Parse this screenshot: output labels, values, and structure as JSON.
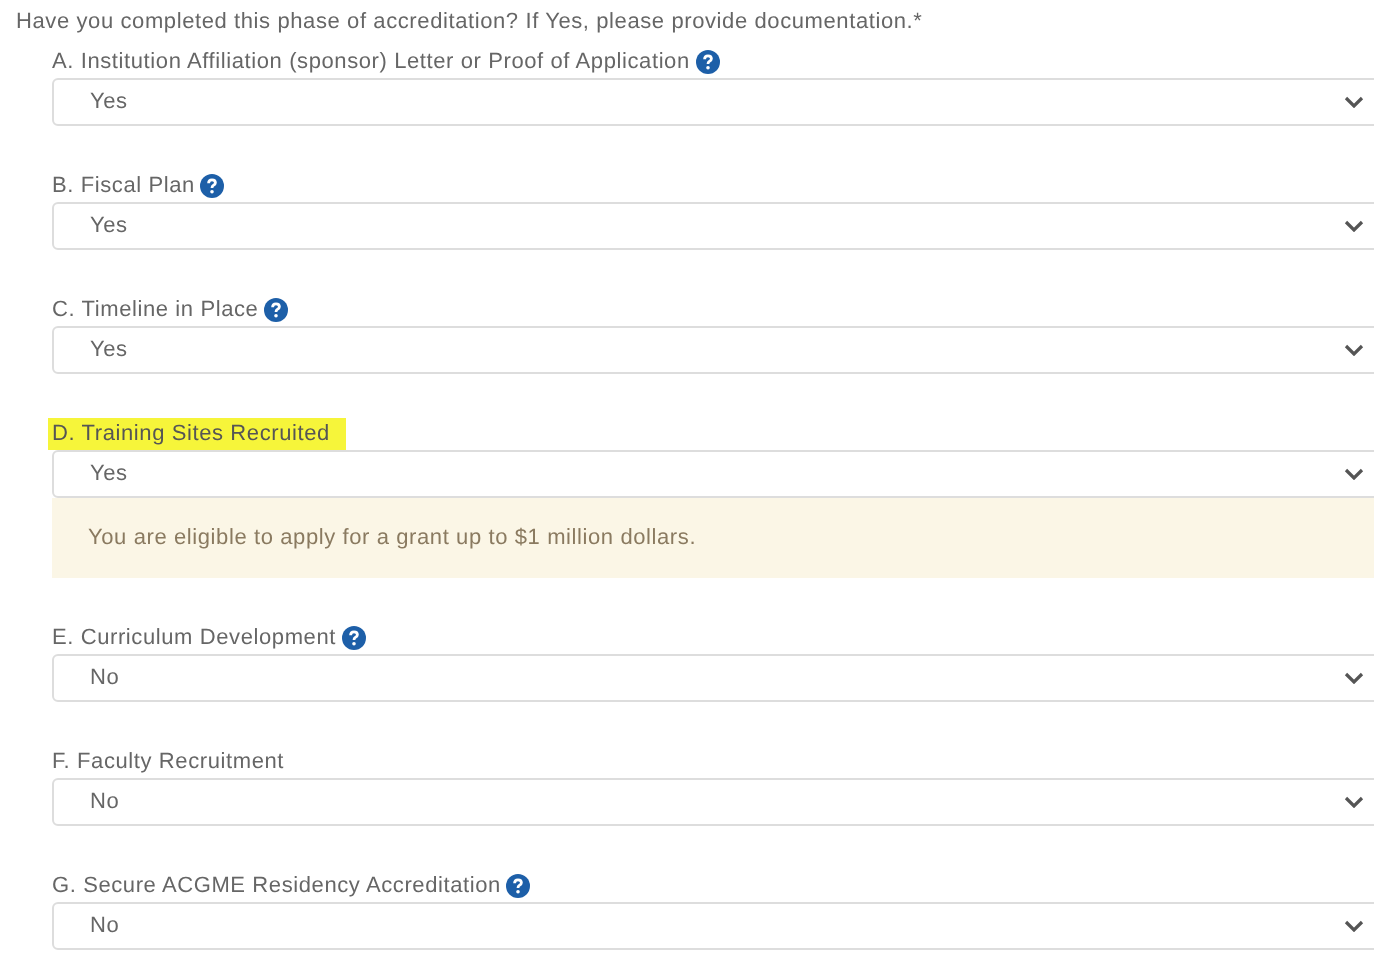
{
  "question": "Have you completed this phase of accreditation? If Yes, please provide documentation.*",
  "items": [
    {
      "label": "A. Institution Affiliation (sponsor) Letter or Proof of Application",
      "help": true,
      "highlighted": false,
      "value": "Yes"
    },
    {
      "label": "B. Fiscal Plan",
      "help": true,
      "highlighted": false,
      "value": "Yes"
    },
    {
      "label": "C. Timeline in Place",
      "help": true,
      "highlighted": false,
      "value": "Yes"
    },
    {
      "label": "D. Training Sites Recruited",
      "help": false,
      "highlighted": true,
      "value": "Yes",
      "notice": "You are eligible to apply for a grant up to $1 million dollars."
    },
    {
      "label": "E. Curriculum Development",
      "help": true,
      "highlighted": false,
      "value": "No"
    },
    {
      "label": "F. Faculty Recruitment",
      "help": false,
      "highlighted": false,
      "value": "No"
    },
    {
      "label": "G. Secure ACGME Residency Accreditation",
      "help": true,
      "highlighted": false,
      "value": "No"
    }
  ]
}
